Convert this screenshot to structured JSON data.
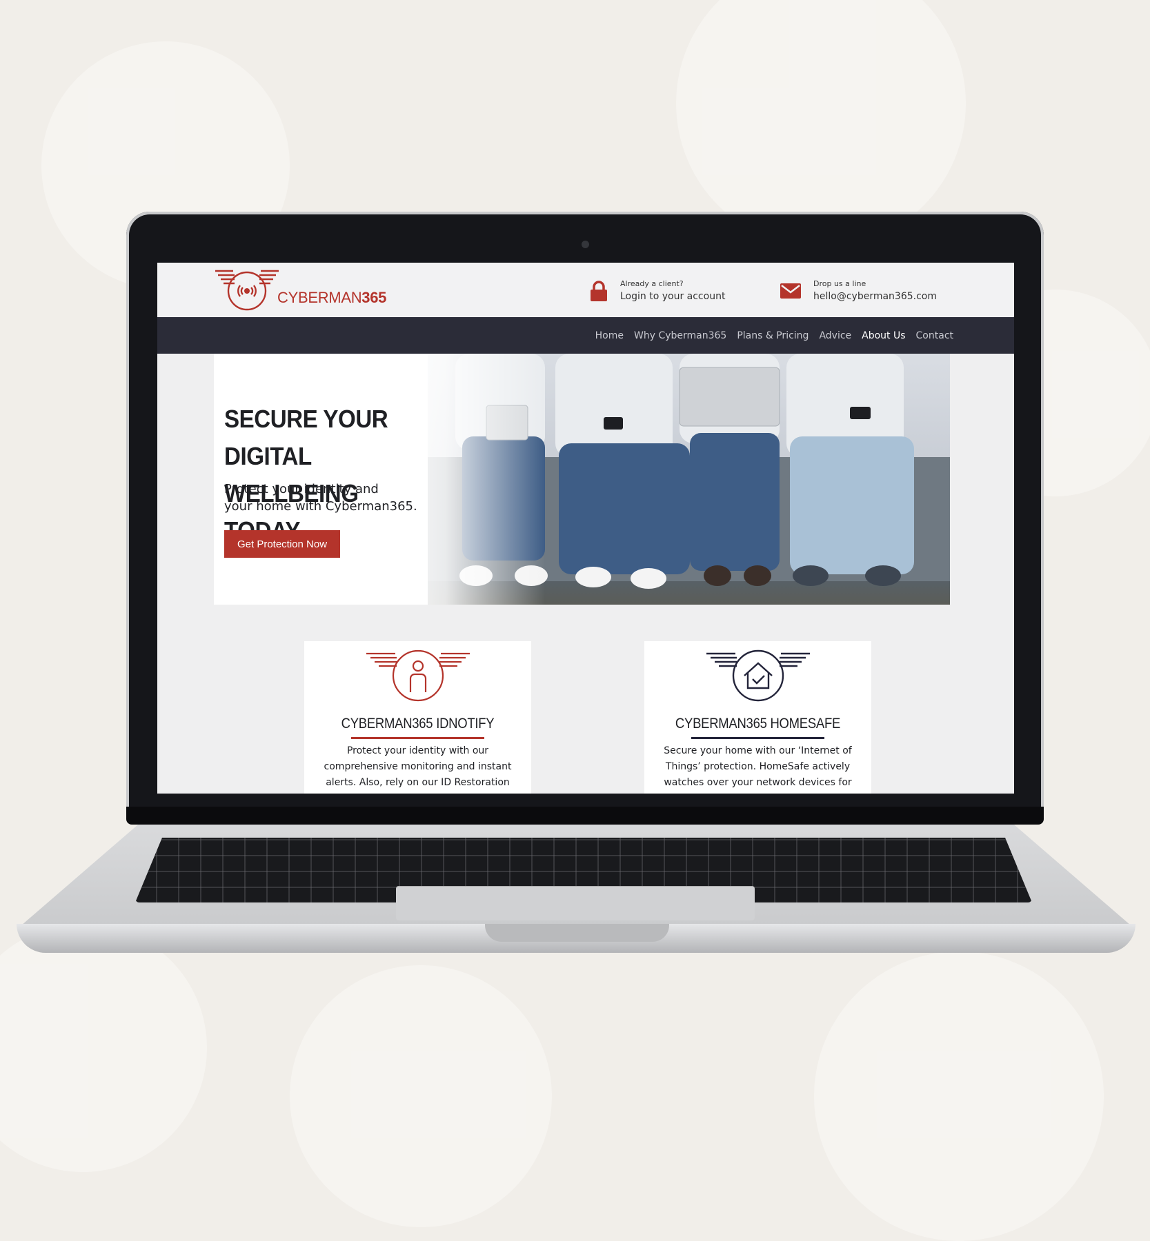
{
  "colors": {
    "brand_red": "#b4342b",
    "nav_bg": "#2b2c38",
    "navy": "#23243a"
  },
  "header": {
    "logo_text": "CYBERMAN",
    "logo_text_bold": "365",
    "login": {
      "small": "Already a client?",
      "big": "Login to your account",
      "icon": "lock-icon"
    },
    "mail": {
      "small": "Drop us a line",
      "big": "hello@cyberman365.com",
      "icon": "envelope-icon"
    }
  },
  "nav": {
    "items": [
      {
        "label": "Home"
      },
      {
        "label": "Why Cyberman365"
      },
      {
        "label": "Plans & Pricing"
      },
      {
        "label": "Advice"
      },
      {
        "label": "About Us",
        "active": true
      },
      {
        "label": "Contact"
      }
    ]
  },
  "hero": {
    "title_line1": "Secure your digital",
    "title_line2": "wellbeing today",
    "subtitle_line1": "Protect your identity and",
    "subtitle_line2": "your home with Cyberman365.",
    "cta": "Get Protection Now"
  },
  "cards": [
    {
      "title": "Cyberman365 IDnotify",
      "icon": "person-shield-icon",
      "text": "Protect your identity with our comprehensive monitoring and instant alerts. Also, rely on our ID Restoration and"
    },
    {
      "title": "Cyberman365 HomeSafe",
      "icon": "house-shield-icon",
      "text": "Secure your home with our ‘Internet of Things’ protection. HomeSafe actively watches over your network devices for cyber"
    }
  ]
}
